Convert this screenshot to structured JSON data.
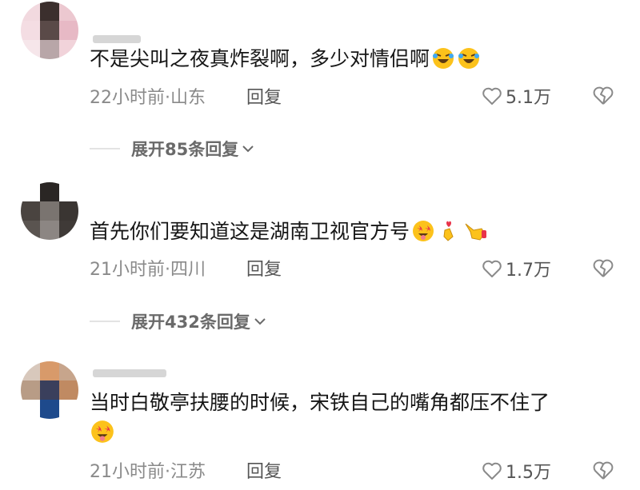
{
  "comments": [
    {
      "text": "不是尖叫之夜真炸裂啊，多少对情侣啊",
      "emojis": [
        "rolling-on-floor-laughing",
        "rolling-on-floor-laughing"
      ],
      "time_location": "22小时前·山东",
      "reply_label": "回复",
      "likes": "5.1万",
      "expand_label": "展开85条回复"
    },
    {
      "text": "首先你们要知道这是湖南卫视官方号",
      "emojis": [
        "star-struck-tongue",
        "finger-heart",
        "pointing-hand"
      ],
      "time_location": "21小时前·四川",
      "reply_label": "回复",
      "likes": "1.7万",
      "expand_label": "展开432条回复"
    },
    {
      "text": "当时白敬亭扶腰的时候，宋铁自己的嘴角都压不住了",
      "emojis": [
        "star-struck-tongue"
      ],
      "time_location": "21小时前·江苏",
      "reply_label": "回复",
      "likes": "1.5万"
    }
  ],
  "colors": {
    "primary_text": "#161616",
    "secondary_text": "#8a8a8a",
    "reply_text": "#555555",
    "divider": "#e3e3e3"
  }
}
